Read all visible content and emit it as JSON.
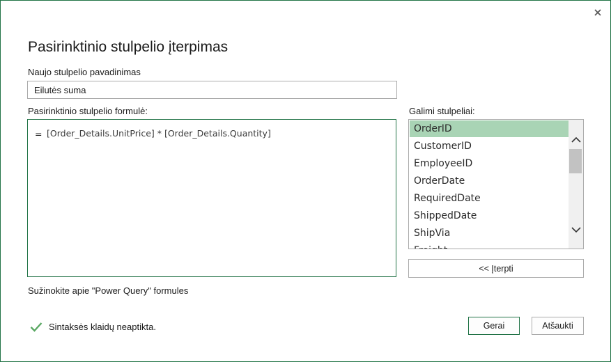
{
  "dialog": {
    "title": "Pasirinktinio stulpelio įterpimas",
    "close_icon": "close-icon"
  },
  "name_field": {
    "label": "Naujo stulpelio pavadinimas",
    "value": "Eilutės suma"
  },
  "formula": {
    "label": "Pasirinktinio stulpelio formulė:",
    "equals": "=",
    "text": "[Order_Details.UnitPrice] * [Order_Details.Quantity]"
  },
  "available_columns": {
    "label": "Galimi stulpeliai:",
    "items": [
      {
        "label": "OrderID",
        "selected": true
      },
      {
        "label": "CustomerID",
        "selected": false
      },
      {
        "label": "EmployeeID",
        "selected": false
      },
      {
        "label": "OrderDate",
        "selected": false
      },
      {
        "label": "RequiredDate",
        "selected": false
      },
      {
        "label": "ShippedDate",
        "selected": false
      },
      {
        "label": "ShipVia",
        "selected": false
      },
      {
        "label": "Freight",
        "selected": false
      }
    ],
    "insert_button": "<< Įterpti"
  },
  "learn_link": "Sužinokite apie \"Power Query\" formules",
  "status": {
    "icon": "checkmark-icon",
    "text": "Sintaksės klaidų neaptikta."
  },
  "buttons": {
    "ok": "Gerai",
    "cancel": "Atšaukti"
  },
  "colors": {
    "accent": "#217346",
    "selection": "#a9d4b5",
    "check": "#5aa863"
  }
}
